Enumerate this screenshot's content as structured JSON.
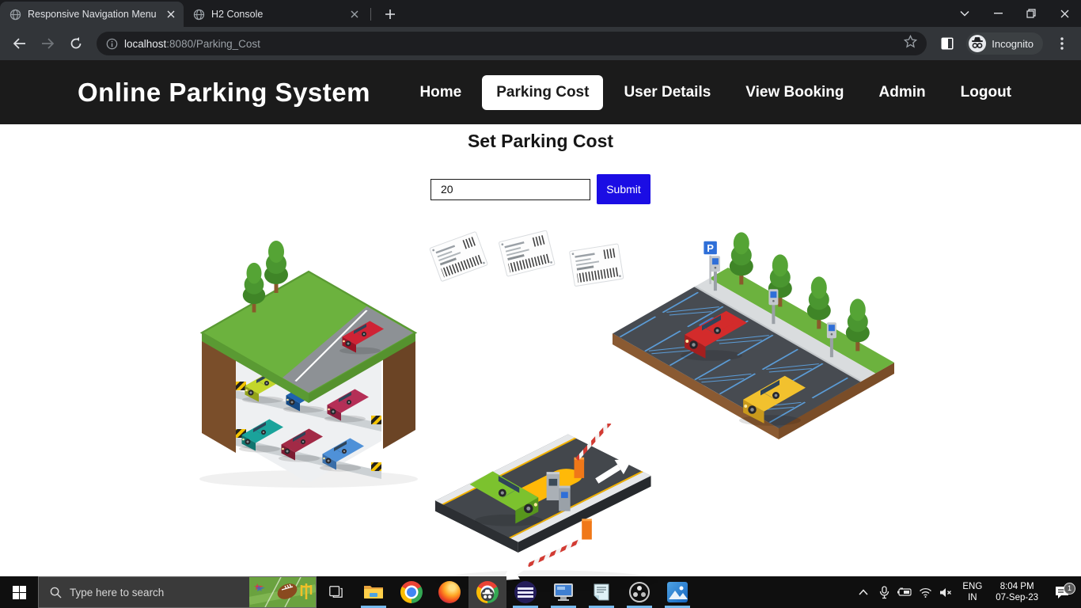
{
  "browser": {
    "tabs": [
      {
        "title": "Responsive Navigation Menu"
      },
      {
        "title": "H2 Console"
      }
    ],
    "url_host": "localhost",
    "url_rest": ":8080/Parking_Cost",
    "incognito_label": "Incognito"
  },
  "page": {
    "brand": "Online Parking System",
    "nav": {
      "items": [
        {
          "label": "Home",
          "active": false
        },
        {
          "label": "Parking Cost",
          "active": true
        },
        {
          "label": "User Details",
          "active": false
        },
        {
          "label": "View Booking",
          "active": false
        },
        {
          "label": "Admin",
          "active": false
        },
        {
          "label": "Logout",
          "active": false
        }
      ]
    },
    "heading": "Set Parking Cost",
    "form": {
      "cost_value": "20",
      "submit_label": "Submit"
    },
    "illustrations": {
      "p_sign": "P"
    }
  },
  "taskbar": {
    "search_placeholder": "Type here to search",
    "tray": {
      "language": "ENG",
      "region": "IN",
      "time": "8:04 PM",
      "date": "07-Sep-23",
      "notification_count": "1"
    }
  },
  "colors": {
    "accent_blue": "#1b0de4",
    "site_nav_bg": "#1b1b1b",
    "active_tab_bg": "#323539"
  }
}
